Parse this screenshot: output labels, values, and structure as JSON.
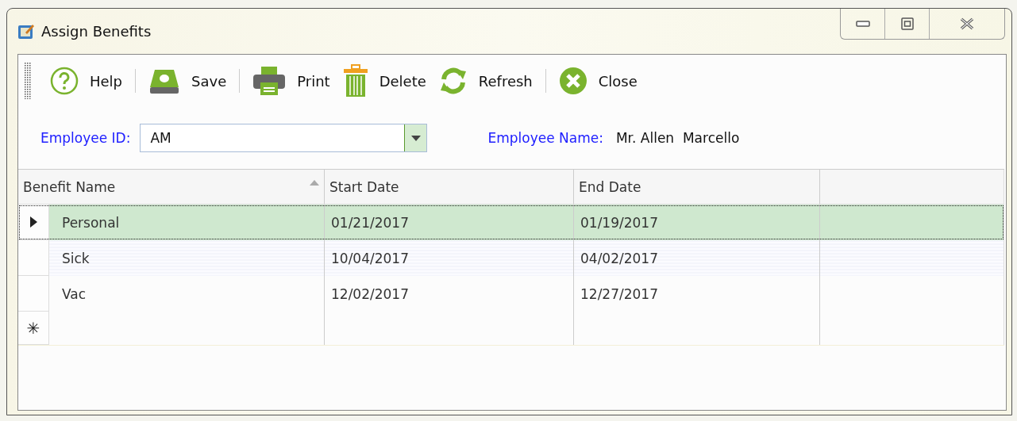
{
  "window": {
    "title": "Assign Benefits"
  },
  "toolbar": {
    "groups": [
      [
        {
          "label": "Help",
          "kind": "help"
        }
      ],
      [
        {
          "label": "Save",
          "kind": "save"
        }
      ],
      [
        {
          "label": "Print",
          "kind": "print"
        },
        {
          "label": "Delete",
          "kind": "delete"
        },
        {
          "label": "Refresh",
          "kind": "refresh"
        }
      ],
      [
        {
          "label": "Close",
          "kind": "close"
        }
      ]
    ]
  },
  "employee": {
    "id_label": "Employee ID:",
    "id_value": "AM",
    "name_label": "Employee Name:",
    "name_value": "Mr. Allen  Marcello"
  },
  "table": {
    "columns": [
      {
        "label": "Benefit Name",
        "sorted": true
      },
      {
        "label": "Start Date",
        "sorted": false
      },
      {
        "label": "End Date",
        "sorted": false
      }
    ],
    "rows": [
      {
        "cells": [
          "Personal",
          "01/21/2017",
          "01/19/2017"
        ],
        "selected": true
      },
      {
        "cells": [
          "Sick",
          "10/04/2017",
          "04/02/2017"
        ],
        "selected": false
      },
      {
        "cells": [
          "Vac",
          "12/02/2017",
          "12/27/2017"
        ],
        "selected": false
      }
    ],
    "new_row_marker": "✳"
  }
}
